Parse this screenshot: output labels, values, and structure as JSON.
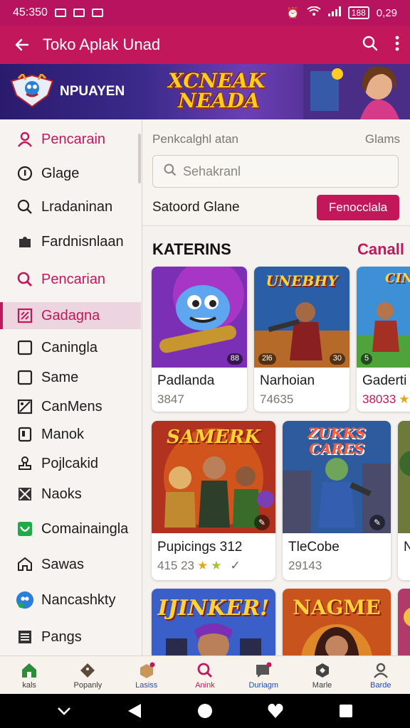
{
  "status": {
    "time": "45:350",
    "right_text": "0,29",
    "battery": "188"
  },
  "app_bar": {
    "title": "Toko Aplak Unad"
  },
  "banner": {
    "brand": "NPUAYEN",
    "promo_line1": "XCNEAK",
    "promo_line2": "NEADA"
  },
  "sidebar": {
    "items": [
      {
        "label": "Pencarain",
        "icon": "person-icon"
      },
      {
        "label": "Glage",
        "icon": "info-icon"
      },
      {
        "label": "Lradaninan",
        "icon": "search-icon"
      },
      {
        "label": "Fardnisnlaan",
        "icon": "puzzle-icon"
      },
      {
        "label": "Pencarian",
        "icon": "search-icon"
      },
      {
        "label": "Gadagna",
        "icon": "grid-icon"
      },
      {
        "label": "Caningla",
        "icon": "square-icon"
      },
      {
        "label": "Same",
        "icon": "square-icon"
      },
      {
        "label": "CanMens",
        "icon": "image-icon"
      },
      {
        "label": "Manok",
        "icon": "phone-icon"
      },
      {
        "label": "Pojlcakid",
        "icon": "stamp-icon"
      },
      {
        "label": "Naoks",
        "icon": "mail-icon"
      },
      {
        "label": "Comainaingla",
        "icon": "shield-icon"
      },
      {
        "label": "Sawas",
        "icon": "home-icon"
      },
      {
        "label": "Nancashkty",
        "icon": "avatar-icon"
      },
      {
        "label": "Pangs",
        "icon": "list-icon"
      }
    ]
  },
  "search": {
    "header": "Penkcalghl atan",
    "header_right": "Glams",
    "placeholder": "Sehakranl",
    "select_label": "Satoord Glane",
    "button": "Fenocclala"
  },
  "section": {
    "title": "KATERINS",
    "link": "Canall"
  },
  "games_row1": [
    {
      "name": "Padlanda",
      "meta": "3847",
      "badge": "88"
    },
    {
      "name": "Narhoian",
      "meta": "74635",
      "thumb_title": "UNEBHY",
      "badge_left": "2l6",
      "badge": "30"
    },
    {
      "name": "Gaderti",
      "meta": "38033",
      "thumb_title": "CIN",
      "badge_left": "5"
    }
  ],
  "games_row2": [
    {
      "name": "Pupicings 312",
      "meta": "415 23",
      "thumb_title": "SAMERK"
    },
    {
      "name": "TleCobe",
      "meta": "29143",
      "thumb_title": "ZUKKS CARES"
    },
    {
      "name": "N",
      "meta": ""
    }
  ],
  "games_row3": [
    {
      "thumb_title": "IJINKER!"
    },
    {
      "thumb_title": "NAGME"
    }
  ],
  "bottom_nav": [
    {
      "label": "kals",
      "icon": "home-icon"
    },
    {
      "label": "Popanly",
      "icon": "diamond-icon"
    },
    {
      "label": "Lasiss",
      "icon": "box-icon"
    },
    {
      "label": "Anink",
      "icon": "search-icon"
    },
    {
      "label": "Duriagm",
      "icon": "chat-icon"
    },
    {
      "label": "Marle",
      "icon": "hexagon-icon"
    },
    {
      "label": "Barde",
      "icon": "person-icon"
    }
  ],
  "colors": {
    "brand": "#c2185b",
    "status": "#b8135f",
    "accent_yellow": "#ffcc22"
  }
}
